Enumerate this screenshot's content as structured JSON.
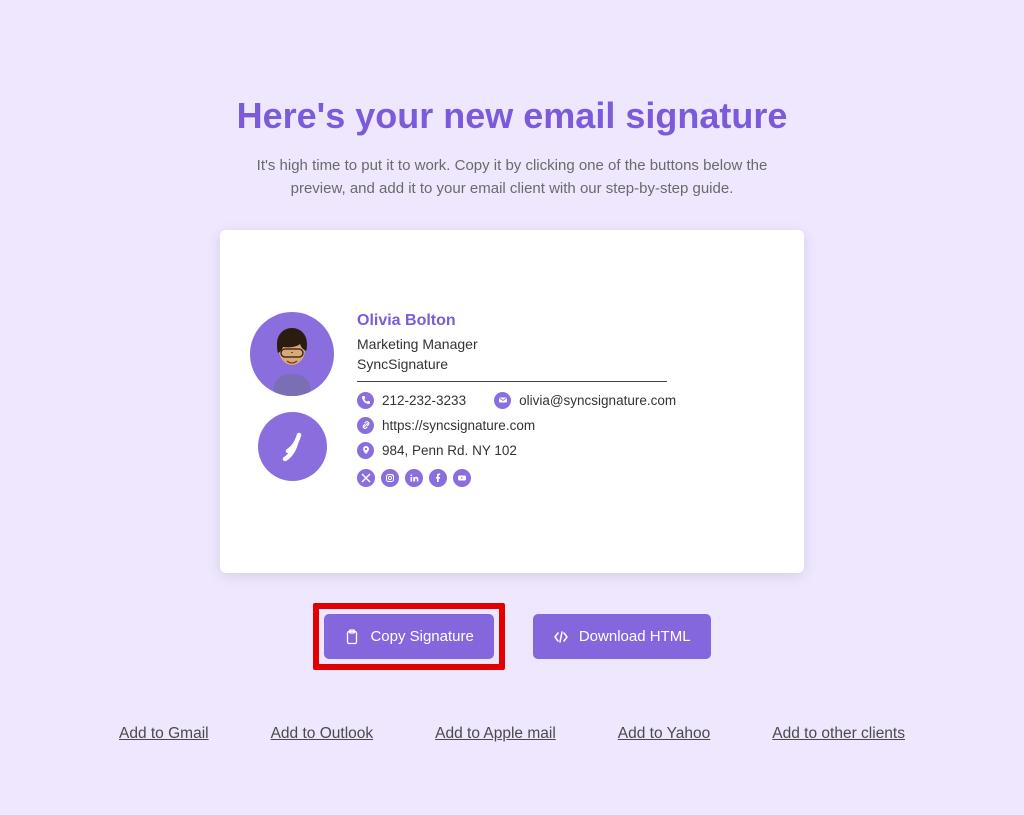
{
  "page": {
    "title": "Here's your new email signature",
    "subtitle": "It's high time to put it to work. Copy it by clicking one of the buttons below the preview, and add it to your email client with our step-by-step guide."
  },
  "signature": {
    "name": "Olivia Bolton",
    "title": "Marketing Manager",
    "company": "SyncSignature",
    "phone": "212-232-3233",
    "email": "olivia@syncsignature.com",
    "website": "https://syncsignature.com",
    "address": "984, Penn Rd. NY 102",
    "socials": [
      "x",
      "instagram",
      "linkedin",
      "facebook",
      "youtube"
    ]
  },
  "actions": {
    "copy": "Copy Signature",
    "download": "Download HTML"
  },
  "links": {
    "gmail": "Add to Gmail",
    "outlook": "Add to Outlook",
    "apple": "Add to Apple mail",
    "yahoo": "Add to Yahoo",
    "other": "Add to other clients"
  },
  "colors": {
    "accent": "#8A6EDD",
    "background": "#EEE7FE",
    "highlight": "#E20000"
  }
}
